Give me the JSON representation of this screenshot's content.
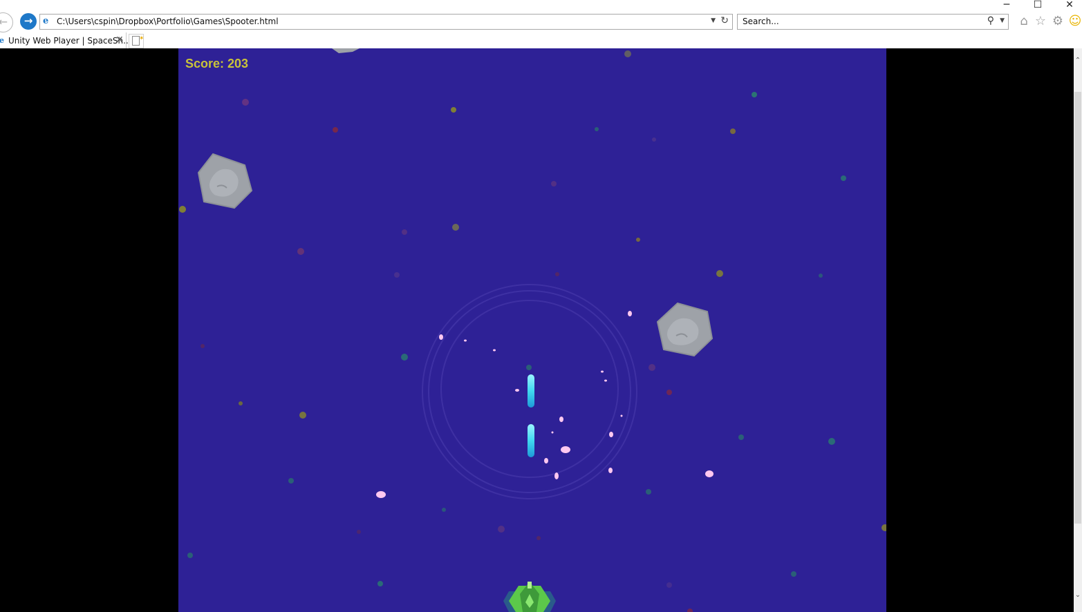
{
  "browser": {
    "address": "C:\\Users\\cspin\\Dropbox\\Portfolio\\Games\\Spooter.html",
    "search_placeholder": "Search...",
    "tab_title": "Unity Web Player | SpaceSh...",
    "icons": {
      "back": "back-arrow-icon",
      "forward": "forward-arrow-icon",
      "home": "home-icon",
      "favorites": "star-icon",
      "settings": "gear-icon",
      "feedback": "smiley-icon",
      "refresh": "refresh-icon",
      "search": "search-icon"
    },
    "window_controls": [
      "minimize",
      "maximize",
      "close"
    ]
  },
  "game": {
    "score_label": "Score:",
    "score_value": "203",
    "colors": {
      "background": "#2e2196",
      "score_text": "#c9c33a",
      "asteroid": "#9ea2a8",
      "laser": "#40d8f0",
      "ship_hull": "#5cc84a",
      "spark": "#ffb8e8"
    }
  }
}
